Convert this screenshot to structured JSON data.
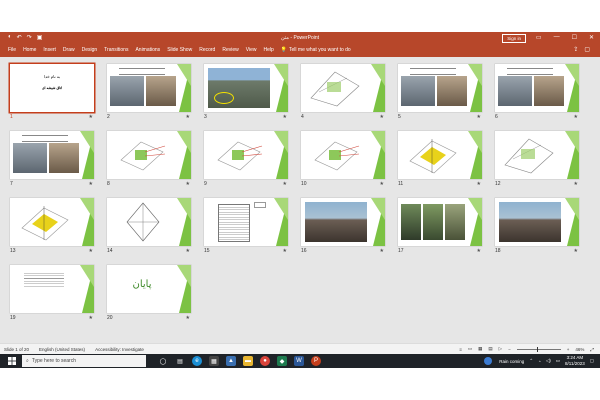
{
  "app": {
    "title": "PowerPoint",
    "doc_name": "متن",
    "sign_in": "Sign in",
    "qat_icons": [
      "autosave-icon",
      "undo-icon",
      "redo-icon",
      "present-icon"
    ],
    "window_controls": [
      "minimize-icon",
      "maximize-icon",
      "close-icon"
    ]
  },
  "ribbon": {
    "tabs": [
      "File",
      "Home",
      "Insert",
      "Draw",
      "Design",
      "Transitions",
      "Animations",
      "Slide Show",
      "Record",
      "Review",
      "View",
      "Help"
    ],
    "tell_me": "Tell me what you want to do"
  },
  "slides": [
    {
      "num": "1",
      "type": "title",
      "title": "به نام خدا",
      "subtitle": "اتاق شیشه ای",
      "selected": true
    },
    {
      "num": "2",
      "type": "photos2"
    },
    {
      "num": "3",
      "type": "city"
    },
    {
      "num": "4",
      "type": "plan"
    },
    {
      "num": "5",
      "type": "photos2"
    },
    {
      "num": "6",
      "type": "photos2"
    },
    {
      "num": "7",
      "type": "photos2"
    },
    {
      "num": "8",
      "type": "diagram"
    },
    {
      "num": "9",
      "type": "diagram"
    },
    {
      "num": "10",
      "type": "diagram"
    },
    {
      "num": "11",
      "type": "yellow"
    },
    {
      "num": "12",
      "type": "plan"
    },
    {
      "num": "13",
      "type": "yellow"
    },
    {
      "num": "14",
      "type": "section"
    },
    {
      "num": "15",
      "type": "elevation"
    },
    {
      "num": "16",
      "type": "photo1"
    },
    {
      "num": "17",
      "type": "photos3"
    },
    {
      "num": "18",
      "type": "photo1"
    },
    {
      "num": "19",
      "type": "text"
    },
    {
      "num": "20",
      "type": "end",
      "title": "پایان"
    }
  ],
  "status": {
    "slide_info": "Slide 1 of 20",
    "language": "English (United States)",
    "accessibility": "Accessibility: Investigate",
    "zoom": "46%"
  },
  "taskbar": {
    "search_placeholder": "Type here to search",
    "weather": "Rain coming",
    "time": "3:24 AM",
    "date": "8/11/2023"
  },
  "colors": {
    "accent": "#b7472a",
    "slide_green": "#7cc243",
    "selection": "#c43e1c"
  }
}
